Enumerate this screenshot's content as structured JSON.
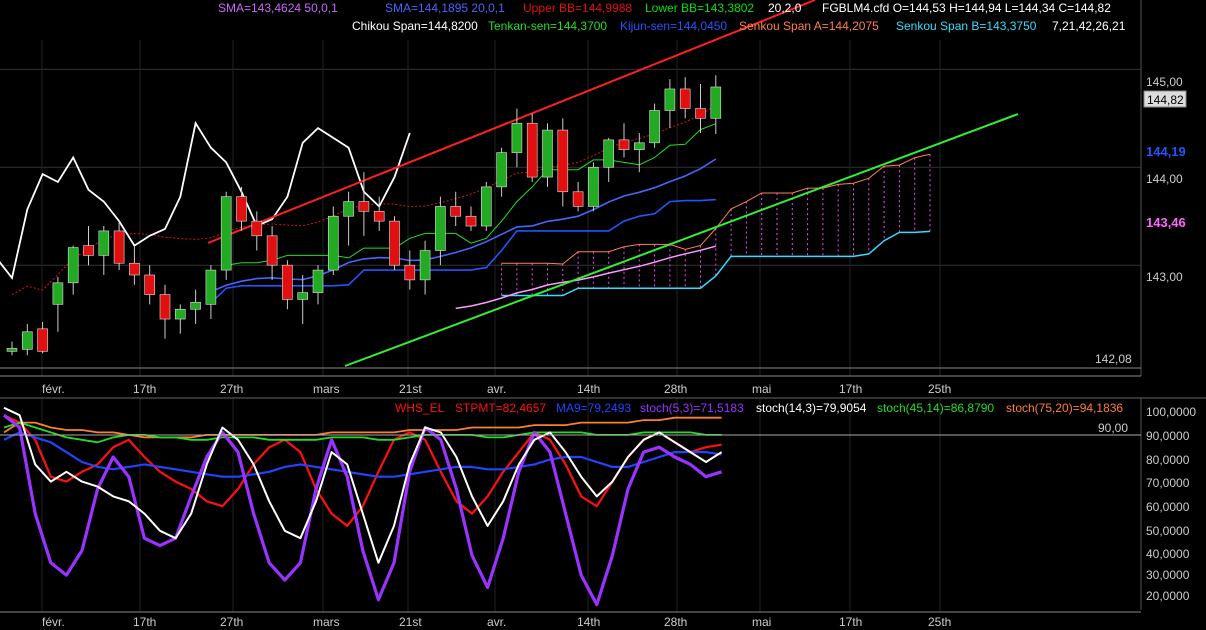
{
  "window": {
    "symbol": "FGBLM4.cfd",
    "ohlc": {
      "open_label": "O=144,53",
      "high_label": "H=144,94",
      "low_label": "L=144,34",
      "close_label": "C=144,82"
    }
  },
  "colors": {
    "background": "#000000",
    "candle_up": "#22aa22",
    "candle_down": "#e01010",
    "sma50": "#cc66ff",
    "sma20": "#4466ff",
    "bb_upper": "#e01010",
    "bb_lower": "#00e000",
    "chikou": "#ffffff",
    "tenkan": "#22dd22",
    "kijun": "#2255ff",
    "senkou_a": "#ff7f50",
    "senkou_b": "#33ddff",
    "cloud_fill": "#ff44ff",
    "channel_upper": "#ff2020",
    "channel_lower": "#33ee33",
    "regression_mid": "#ff99ff",
    "stpmt": "#ff1010",
    "ma9": "#2244ff",
    "stoch5": "#9933ff",
    "stoch14": "#ffffff",
    "stoch45": "#22dd22",
    "stoch75": "#ff7f30"
  },
  "legend_top_row": [
    {
      "text": "SMA=143,4624  50,0,1",
      "color": "#cc66ff"
    },
    {
      "text": "SMA=144,1895  20,0,1",
      "color": "#4466ff"
    },
    {
      "text": "Upper BB=144,9988",
      "color": "#e01010"
    },
    {
      "text": "Lower BB=143,3802",
      "color": "#00e000"
    },
    {
      "text": "20,2,0",
      "color": "#ffffff"
    },
    {
      "text": "FGBLM4.cfd O=144,53 H=144,94 L=144,34 C=144,82",
      "color": "#ffffff"
    }
  ],
  "legend_second_row": [
    {
      "text": "Chikou Span=144,8200",
      "color": "#ffffff"
    },
    {
      "text": "Tenkan-sen=144,3700",
      "color": "#22dd22"
    },
    {
      "text": "Kijun-sen=144,0450",
      "color": "#2255ff"
    },
    {
      "text": "Senkou Span A=144,2075",
      "color": "#ff7f50"
    },
    {
      "text": "Senkou Span B=143,3750",
      "color": "#33ddff"
    },
    {
      "text": "7,21,42,26,21",
      "color": "#ffffff"
    }
  ],
  "legend_oscillator": [
    {
      "text": "WHS_EL",
      "color": "#ff1010"
    },
    {
      "text": "STPMT=82,4657",
      "color": "#ff1010"
    },
    {
      "text": "MA9=79,2493",
      "color": "#2244ff"
    },
    {
      "text": "stoch(5,3)=71,5183",
      "color": "#9933ff"
    },
    {
      "text": "stoch(14,3)=79,9054",
      "color": "#ffffff"
    },
    {
      "text": "stoch(45,14)=86,8790",
      "color": "#22dd22"
    },
    {
      "text": "stoch(75,20)=94,1836",
      "color": "#ff7f30"
    }
  ],
  "price_axis": {
    "ticks": [
      "145,00",
      "144,00",
      "143,00"
    ],
    "last_price_box": "144,82",
    "marker_blue": "144,19",
    "marker_magenta": "143,46",
    "low_label": "142,08",
    "marker_blue_color": "#2255ff",
    "marker_magenta_color": "#ff66ff"
  },
  "osc_axis": {
    "ticks": [
      "100,0000",
      "90,0000",
      "80,0000",
      "70,0000",
      "60,0000",
      "50,0000",
      "40,0000",
      "30,0000",
      "20,0000"
    ],
    "level_label": "90,00"
  },
  "x_axis": {
    "labels": [
      "févr.",
      "17th",
      "27th",
      "mars",
      "21st",
      "avr.",
      "14th",
      "28th",
      "mai",
      "17th",
      "25th"
    ]
  },
  "chart_data": [
    {
      "type": "candlestick",
      "ylim": [
        141.95,
        145.3
      ],
      "x_labels": [
        "févr.",
        "17th",
        "27th",
        "mars",
        "21st",
        "avr.",
        "14th",
        "28th",
        "mai",
        "17th",
        "25th"
      ],
      "candles": [
        {
          "o": 142.12,
          "h": 142.22,
          "l": 142.08,
          "c": 142.15
        },
        {
          "o": 142.14,
          "h": 142.4,
          "l": 142.08,
          "c": 142.32
        },
        {
          "o": 142.35,
          "h": 142.42,
          "l": 142.1,
          "c": 142.12
        },
        {
          "o": 142.6,
          "h": 142.88,
          "l": 142.32,
          "c": 142.82
        },
        {
          "o": 142.82,
          "h": 143.2,
          "l": 142.7,
          "c": 143.18
        },
        {
          "o": 143.2,
          "h": 143.4,
          "l": 143.0,
          "c": 143.1
        },
        {
          "o": 143.1,
          "h": 143.4,
          "l": 142.9,
          "c": 143.35
        },
        {
          "o": 143.35,
          "h": 143.45,
          "l": 142.95,
          "c": 143.02
        },
        {
          "o": 143.02,
          "h": 143.2,
          "l": 142.8,
          "c": 142.9
        },
        {
          "o": 142.9,
          "h": 143.0,
          "l": 142.6,
          "c": 142.7
        },
        {
          "o": 142.7,
          "h": 142.8,
          "l": 142.25,
          "c": 142.45
        },
        {
          "o": 142.45,
          "h": 142.6,
          "l": 142.3,
          "c": 142.55
        },
        {
          "o": 142.55,
          "h": 142.75,
          "l": 142.4,
          "c": 142.62
        },
        {
          "o": 142.6,
          "h": 143.0,
          "l": 142.45,
          "c": 142.95
        },
        {
          "o": 142.95,
          "h": 143.75,
          "l": 142.85,
          "c": 143.7
        },
        {
          "o": 143.7,
          "h": 143.8,
          "l": 143.35,
          "c": 143.45
        },
        {
          "o": 143.45,
          "h": 143.55,
          "l": 143.15,
          "c": 143.3
        },
        {
          "o": 143.3,
          "h": 143.4,
          "l": 142.85,
          "c": 143.0
        },
        {
          "o": 143.0,
          "h": 143.05,
          "l": 142.55,
          "c": 142.65
        },
        {
          "o": 142.65,
          "h": 142.9,
          "l": 142.4,
          "c": 142.72
        },
        {
          "o": 142.72,
          "h": 143.0,
          "l": 142.6,
          "c": 142.95
        },
        {
          "o": 142.95,
          "h": 143.6,
          "l": 142.9,
          "c": 143.5
        },
        {
          "o": 143.5,
          "h": 143.75,
          "l": 143.2,
          "c": 143.65
        },
        {
          "o": 143.65,
          "h": 143.95,
          "l": 143.3,
          "c": 143.55
        },
        {
          "o": 143.55,
          "h": 143.7,
          "l": 143.35,
          "c": 143.45
        },
        {
          "o": 143.45,
          "h": 143.5,
          "l": 142.95,
          "c": 143.0
        },
        {
          "o": 143.0,
          "h": 143.15,
          "l": 142.75,
          "c": 142.85
        },
        {
          "o": 142.85,
          "h": 143.25,
          "l": 142.7,
          "c": 143.15
        },
        {
          "o": 143.15,
          "h": 143.7,
          "l": 143.0,
          "c": 143.6
        },
        {
          "o": 143.6,
          "h": 143.75,
          "l": 143.4,
          "c": 143.5
        },
        {
          "o": 143.5,
          "h": 143.6,
          "l": 143.35,
          "c": 143.4
        },
        {
          "o": 143.4,
          "h": 143.85,
          "l": 143.35,
          "c": 143.8
        },
        {
          "o": 143.8,
          "h": 144.2,
          "l": 143.7,
          "c": 144.15
        },
        {
          "o": 144.15,
          "h": 144.6,
          "l": 144.0,
          "c": 144.45
        },
        {
          "o": 144.45,
          "h": 144.55,
          "l": 143.85,
          "c": 143.9
        },
        {
          "o": 143.9,
          "h": 144.45,
          "l": 143.8,
          "c": 144.38
        },
        {
          "o": 144.38,
          "h": 144.5,
          "l": 143.6,
          "c": 143.75
        },
        {
          "o": 143.75,
          "h": 143.85,
          "l": 143.55,
          "c": 143.6
        },
        {
          "o": 143.6,
          "h": 144.05,
          "l": 143.55,
          "c": 144.0
        },
        {
          "o": 144.0,
          "h": 144.3,
          "l": 143.85,
          "c": 144.28
        },
        {
          "o": 144.28,
          "h": 144.45,
          "l": 144.1,
          "c": 144.18
        },
        {
          "o": 144.18,
          "h": 144.35,
          "l": 143.95,
          "c": 144.25
        },
        {
          "o": 144.25,
          "h": 144.65,
          "l": 144.2,
          "c": 144.58
        },
        {
          "o": 144.58,
          "h": 144.9,
          "l": 144.4,
          "c": 144.8
        },
        {
          "o": 144.8,
          "h": 144.92,
          "l": 144.5,
          "c": 144.6
        },
        {
          "o": 144.6,
          "h": 144.85,
          "l": 144.35,
          "c": 144.5
        },
        {
          "o": 144.5,
          "h": 144.94,
          "l": 144.34,
          "c": 144.82
        }
      ]
    },
    {
      "type": "line",
      "ylim": [
        15,
        102
      ],
      "x_labels": [
        "févr.",
        "17th",
        "27th",
        "mars",
        "21st",
        "avr.",
        "14th",
        "28th",
        "mai",
        "17th",
        "25th"
      ],
      "series": [
        {
          "name": "STPMT",
          "values": [
            95,
            92,
            85,
            70,
            68,
            72,
            75,
            82,
            85,
            78,
            72,
            68,
            65,
            60,
            58,
            65,
            75,
            82,
            85,
            80,
            65,
            55,
            50,
            58,
            72,
            85,
            88,
            85,
            72,
            60,
            55,
            62,
            72,
            80,
            88,
            85,
            75,
            62,
            58,
            68,
            78,
            85,
            88,
            84,
            80,
            82,
            83
          ]
        },
        {
          "name": "MA9",
          "values": [
            85,
            88,
            86,
            84,
            80,
            76,
            74,
            73,
            74,
            75,
            74,
            73,
            72,
            71,
            70,
            70,
            71,
            72,
            74,
            75,
            74,
            73,
            72,
            71,
            70,
            70,
            71,
            72,
            73,
            74,
            74,
            73,
            73,
            74,
            75,
            77,
            78,
            78,
            76,
            74,
            74,
            76,
            78,
            80,
            80,
            80,
            79
          ]
        },
        {
          "name": "stoch(5,3)",
          "values": [
            95,
            90,
            55,
            35,
            30,
            40,
            65,
            78,
            70,
            45,
            42,
            45,
            62,
            78,
            88,
            80,
            55,
            35,
            28,
            35,
            65,
            85,
            70,
            40,
            20,
            35,
            72,
            90,
            85,
            65,
            38,
            25,
            45,
            72,
            88,
            80,
            55,
            30,
            18,
            38,
            65,
            80,
            82,
            78,
            75,
            70,
            72
          ]
        },
        {
          "name": "stoch(14,3)",
          "values": [
            98,
            95,
            75,
            68,
            72,
            68,
            66,
            62,
            60,
            55,
            48,
            45,
            55,
            75,
            90,
            85,
            75,
            60,
            48,
            45,
            60,
            80,
            75,
            55,
            35,
            50,
            75,
            90,
            88,
            78,
            62,
            50,
            60,
            75,
            85,
            88,
            80,
            70,
            62,
            68,
            78,
            85,
            88,
            84,
            80,
            76,
            80
          ]
        },
        {
          "name": "stoch(45,14)",
          "values": [
            90,
            92,
            90,
            88,
            86,
            85,
            84,
            86,
            87,
            87,
            86,
            86,
            85,
            85,
            86,
            86,
            86,
            85,
            85,
            85,
            85,
            86,
            86,
            86,
            85,
            85,
            86,
            87,
            87,
            87,
            87,
            86,
            86,
            87,
            88,
            88,
            88,
            88,
            87,
            87,
            87,
            88,
            88,
            88,
            88,
            87,
            87
          ]
        },
        {
          "name": "stoch(75,20)",
          "values": [
            88,
            92,
            92,
            90,
            89,
            89,
            88,
            88,
            87,
            86,
            86,
            86,
            86,
            87,
            87,
            87,
            87,
            87,
            87,
            87,
            87,
            88,
            88,
            88,
            88,
            88,
            89,
            89,
            89,
            89,
            90,
            90,
            90,
            90,
            91,
            91,
            91,
            92,
            92,
            92,
            92,
            93,
            93,
            94,
            94,
            94,
            94
          ]
        }
      ]
    }
  ]
}
